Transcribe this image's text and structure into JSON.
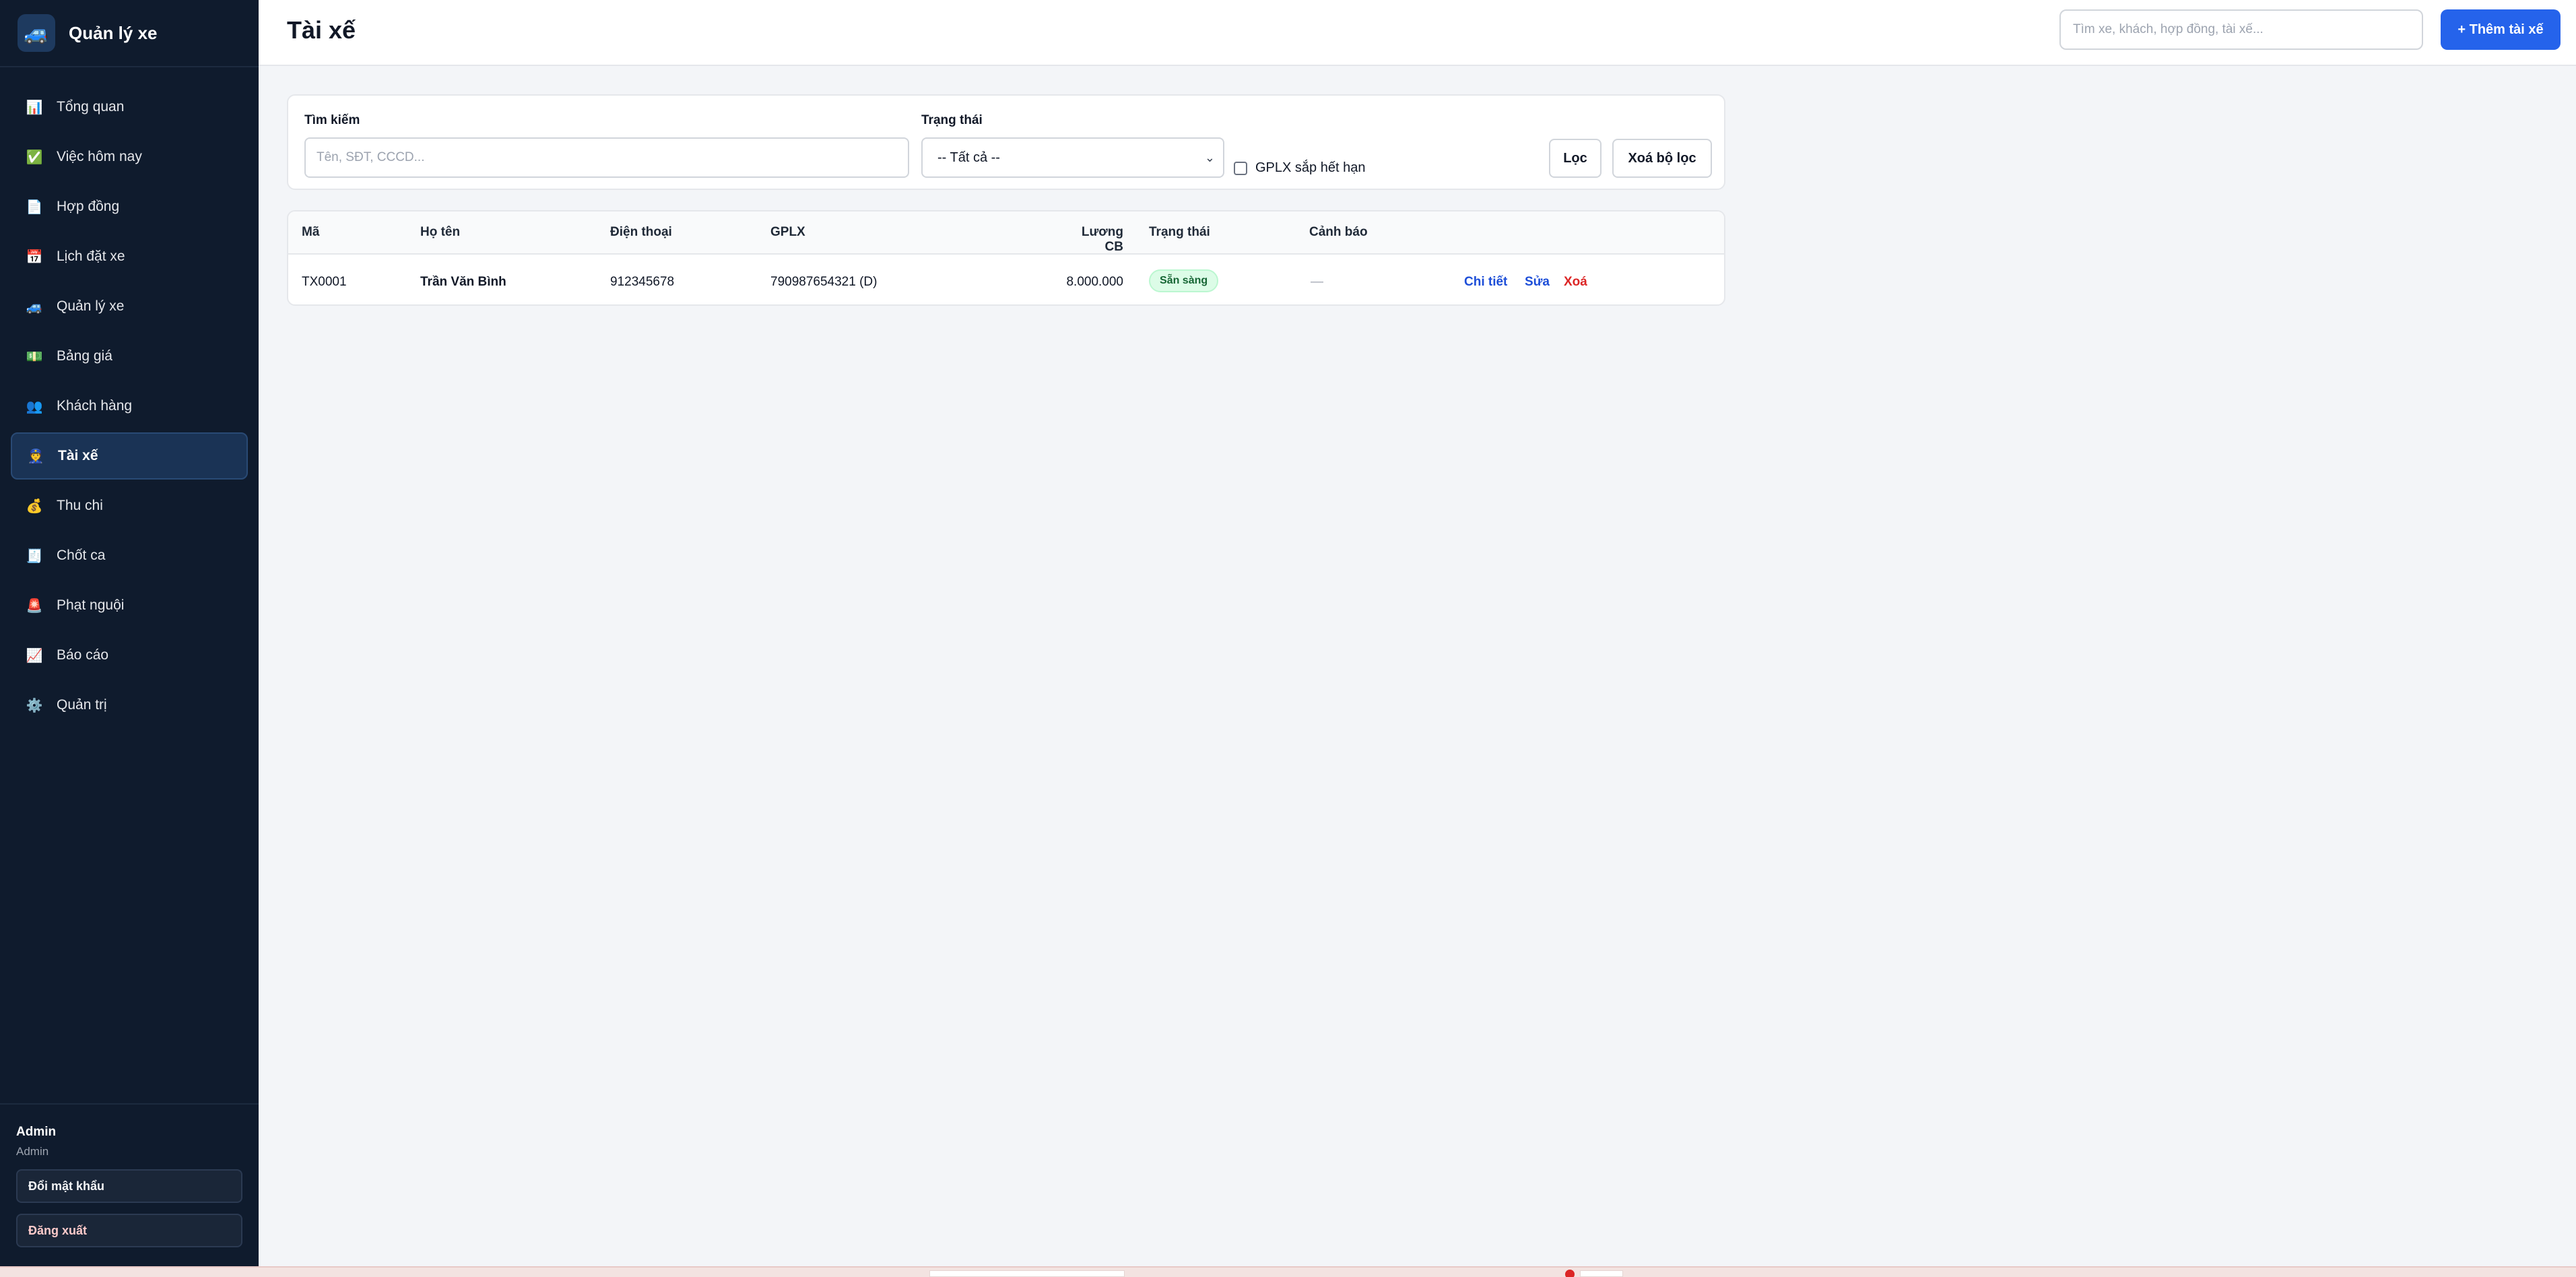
{
  "app": {
    "name": "Quản lý xe",
    "logo_icon": "🚙"
  },
  "sidebar": {
    "items": [
      {
        "label": "Tổng quan",
        "icon": "📊",
        "icon_name": "chart-icon"
      },
      {
        "label": "Việc hôm nay",
        "icon": "✅",
        "icon_name": "checkmark-icon"
      },
      {
        "label": "Hợp đồng",
        "icon": "📄",
        "icon_name": "document-icon"
      },
      {
        "label": "Lịch đặt xe",
        "icon": "📅",
        "icon_name": "calendar-icon"
      },
      {
        "label": "Quản lý xe",
        "icon": "🚙",
        "icon_name": "car-icon"
      },
      {
        "label": "Bảng giá",
        "icon": "💵",
        "icon_name": "money-icon"
      },
      {
        "label": "Khách hàng",
        "icon": "👥",
        "icon_name": "customers-icon"
      },
      {
        "label": "Tài xế",
        "icon": "👮",
        "icon_name": "driver-icon",
        "active": true
      },
      {
        "label": "Thu chi",
        "icon": "💰",
        "icon_name": "money-bag-icon"
      },
      {
        "label": "Chốt ca",
        "icon": "🧾",
        "icon_name": "receipt-icon"
      },
      {
        "label": "Phạt nguội",
        "icon": "🚨",
        "icon_name": "siren-icon"
      },
      {
        "label": "Báo cáo",
        "icon": "📈",
        "icon_name": "report-icon"
      },
      {
        "label": "Quản trị",
        "icon": "⚙️",
        "icon_name": "gear-icon"
      }
    ],
    "user": {
      "name": "Admin",
      "role": "Admin"
    },
    "change_password_label": "Đổi mật khẩu",
    "logout_label": "Đăng xuất"
  },
  "header": {
    "title": "Tài xế",
    "search_placeholder": "Tìm xe, khách, hợp đồng, tài xế...",
    "add_label": "+ Thêm tài xế",
    "accent": "#2563eb"
  },
  "filters": {
    "search_label": "Tìm kiếm",
    "search_placeholder": "Tên, SĐT, CCCD...",
    "status_label": "Trạng thái",
    "status_value": "-- Tất cả --",
    "license_expiring_label": "GPLX sắp hết hạn",
    "filter_button": "Lọc",
    "clear_button": "Xoá bộ lọc"
  },
  "table": {
    "columns": [
      "Mã",
      "Họ tên",
      "Điện thoại",
      "GPLX",
      "Lương CB",
      "Trạng thái",
      "Cảnh báo"
    ],
    "rows": [
      {
        "code": "TX0001",
        "name": "Trần Văn Bình",
        "phone": "912345678",
        "license": "790987654321 (D)",
        "salary": "8.000.000",
        "status": "Sẵn sàng",
        "warning": "—",
        "actions": {
          "detail": "Chi tiết",
          "edit": "Sửa",
          "delete": "Xoá"
        }
      }
    ]
  },
  "colors": {
    "sidebar_bg": "#0f1b2d",
    "status_ready_bg": "#dcfce7",
    "status_ready_text": "#166534",
    "danger": "#dc2626",
    "link": "#1d4ed8"
  }
}
